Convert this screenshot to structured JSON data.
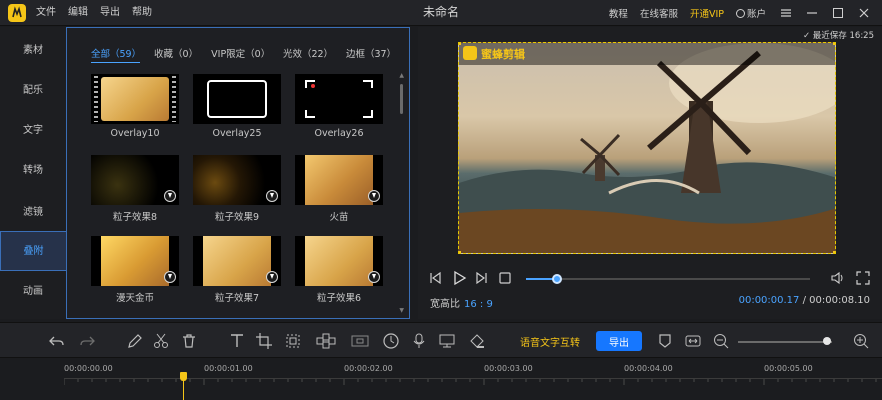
{
  "app": {
    "title": "未命名",
    "menu": [
      "文件",
      "编辑",
      "导出",
      "帮助"
    ],
    "links": {
      "tutorial": "教程",
      "support": "在线客服",
      "vip": "开通VIP",
      "account": "账户"
    }
  },
  "sidebar": {
    "items": [
      {
        "label": "素材"
      },
      {
        "label": "配乐"
      },
      {
        "label": "文字"
      },
      {
        "label": "转场"
      },
      {
        "label": "滤镜"
      },
      {
        "label": "叠附"
      },
      {
        "label": "动画"
      }
    ],
    "active": "叠附"
  },
  "categories": [
    "全部（59）",
    "收藏（0）",
    "VIP限定（0）",
    "光效（22）",
    "边框（37）"
  ],
  "tiles": [
    {
      "label": "Overlay10",
      "download": false
    },
    {
      "label": "Overlay25",
      "download": false
    },
    {
      "label": "Overlay26",
      "download": false
    },
    {
      "label": "粒子效果8",
      "download": true
    },
    {
      "label": "粒子效果9",
      "download": true
    },
    {
      "label": "火苗",
      "download": true
    },
    {
      "label": "漫天金币",
      "download": true
    },
    {
      "label": "粒子效果7",
      "download": true
    },
    {
      "label": "粒子效果6",
      "download": true
    }
  ],
  "preview": {
    "autosave": "最近保存 16:25",
    "brand": "蜜蜂剪辑",
    "ratio_label": "宽高比",
    "ratio_value": "16 : 9",
    "current_time": "00:00:00.17",
    "separator": "/",
    "total_time": "00:00:08.10",
    "progress": 0.11
  },
  "toolbar": {
    "speech_text": "语音文字互转",
    "export_label": "导出",
    "zoom": 0.95
  },
  "timeline": {
    "ticks": [
      "00:00:00.00",
      "00:00:01.00",
      "00:00:02.00",
      "00:00:03.00",
      "00:00:04.00",
      "00:00:05.00"
    ]
  },
  "colors": {
    "accent": "#4aa3ff",
    "brand": "#f5c518",
    "export": "#1677ff"
  }
}
